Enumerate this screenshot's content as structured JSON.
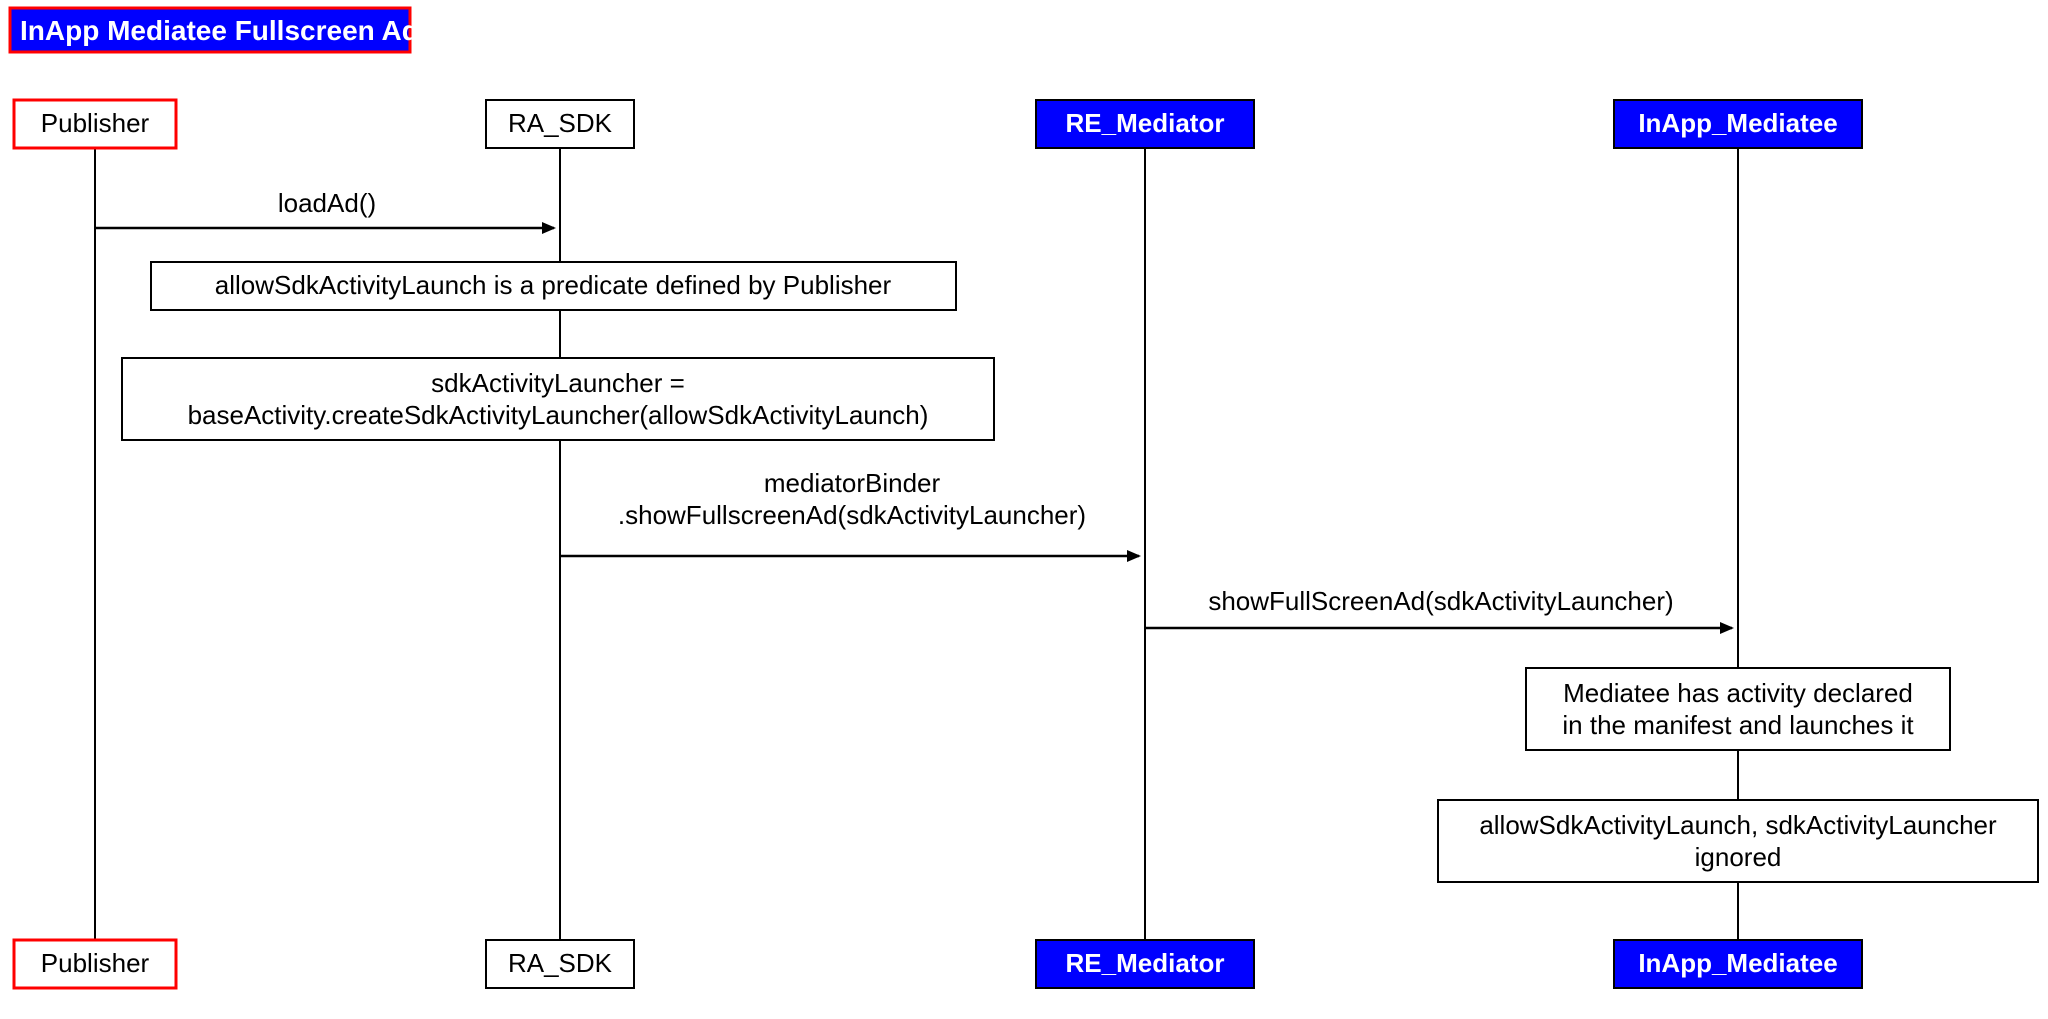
{
  "title": "InApp Mediatee Fullscreen Ad",
  "actors": {
    "publisher": "Publisher",
    "ra_sdk": "RA_SDK",
    "re_mediator": "RE_Mediator",
    "inapp_mediatee": "InApp_Mediatee"
  },
  "messages": {
    "m1": "loadAd()",
    "m2_l1": "mediatorBinder",
    "m2_l2": ".showFullscreenAd(sdkActivityLauncher)",
    "m3": "showFullScreenAd(sdkActivityLauncher)"
  },
  "notes": {
    "n1": "allowSdkActivityLaunch is a predicate defined by Publisher",
    "n2_l1": "sdkActivityLauncher =",
    "n2_l2": "baseActivity.createSdkActivityLauncher(allowSdkActivityLaunch)",
    "n3_l1": "Mediatee has activity declared",
    "n3_l2": "in the manifest and launches it",
    "n4_l1": "allowSdkActivityLaunch, sdkActivityLauncher",
    "n4_l2": "ignored"
  }
}
